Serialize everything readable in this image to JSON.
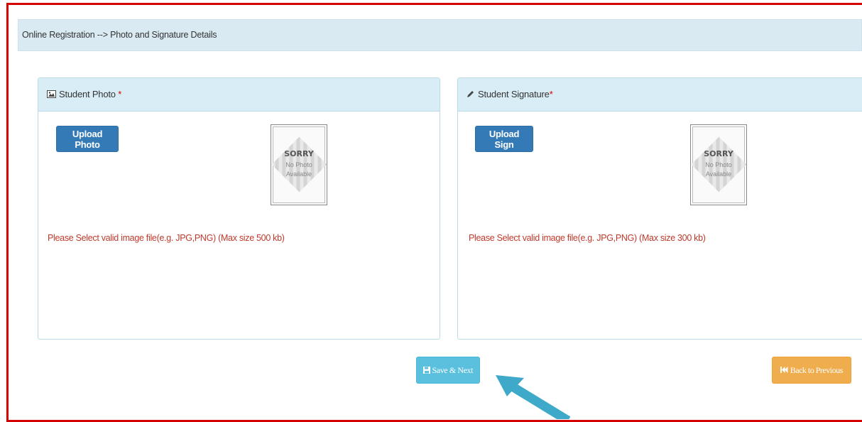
{
  "breadcrumb": "Online Registration --> Photo and Signature Details",
  "photo_panel": {
    "title": "Student Photo",
    "required_mark": "*",
    "icon": "image-icon",
    "button_label": "Upload Photo",
    "placeholder": {
      "line1": "SORRY",
      "line2": "No Photo",
      "line3": "Available"
    },
    "hint": "Please Select valid image file(e.g. JPG,PNG) (Max size 500 kb)"
  },
  "sign_panel": {
    "title": "Student Signature",
    "required_mark": "*",
    "icon": "pencil-icon",
    "button_label": "Upload Sign",
    "placeholder": {
      "line1": "SORRY",
      "line2": "No Photo",
      "line3": "Available"
    },
    "hint": "Please Select valid image file(e.g. JPG,PNG) (Max size 300 kb)"
  },
  "actions": {
    "save_label": "Save & Next",
    "save_icon": "floppy-disk-icon",
    "back_label": "Back to Previous",
    "back_icon": "fast-backward-icon"
  },
  "colors": {
    "frame_border": "#d40000",
    "primary_button": "#337ab7",
    "info_button": "#5bc0de",
    "warning_button": "#f0ad4e",
    "hint_text": "#c0392b",
    "annotation_arrow": "#3fa9c9"
  }
}
